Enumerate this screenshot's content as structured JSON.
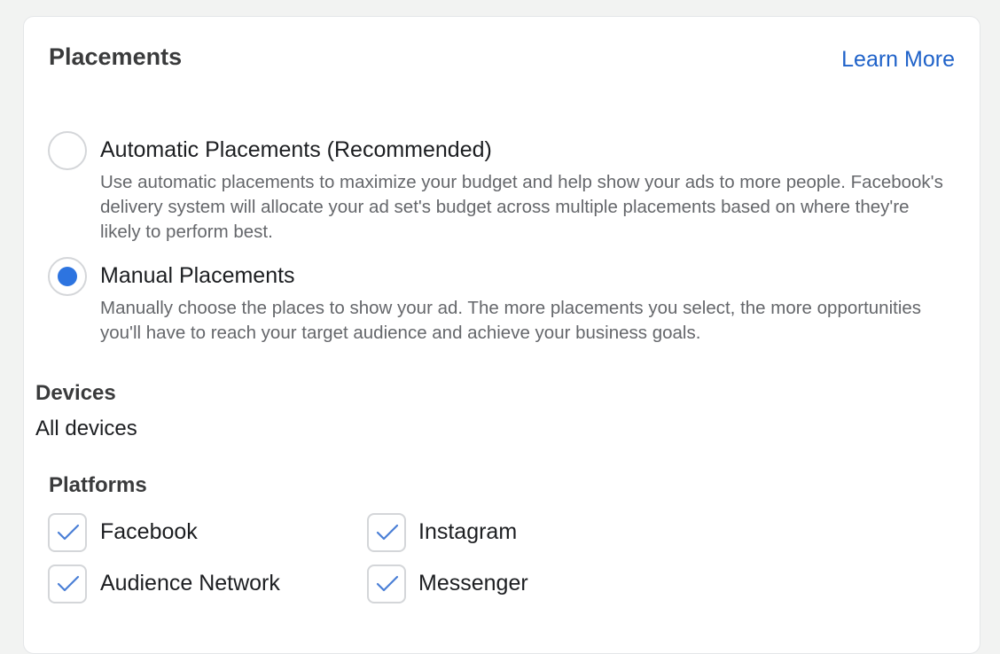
{
  "header": {
    "title": "Placements",
    "learn_more": "Learn More"
  },
  "options": [
    {
      "label": "Automatic Placements (Recommended)",
      "description": "Use automatic placements to maximize your budget and help show your ads to more people. Facebook's delivery system will allocate your ad set's budget across multiple placements based on where they're likely to perform best.",
      "selected": false
    },
    {
      "label": "Manual Placements",
      "description": "Manually choose the places to show your ad. The more placements you select, the more opportunities you'll have to reach your target audience and achieve your business goals.",
      "selected": true
    }
  ],
  "devices": {
    "label": "Devices",
    "value": "All devices"
  },
  "platforms": {
    "label": "Platforms",
    "items": [
      {
        "label": "Facebook",
        "checked": true
      },
      {
        "label": "Instagram",
        "checked": true
      },
      {
        "label": "Audience Network",
        "checked": true
      },
      {
        "label": "Messenger",
        "checked": true
      }
    ]
  },
  "colors": {
    "accent": "#2d74e0",
    "link": "#1f62c9",
    "check": "#4a7fd6"
  },
  "icons": {
    "check": "check-icon"
  }
}
